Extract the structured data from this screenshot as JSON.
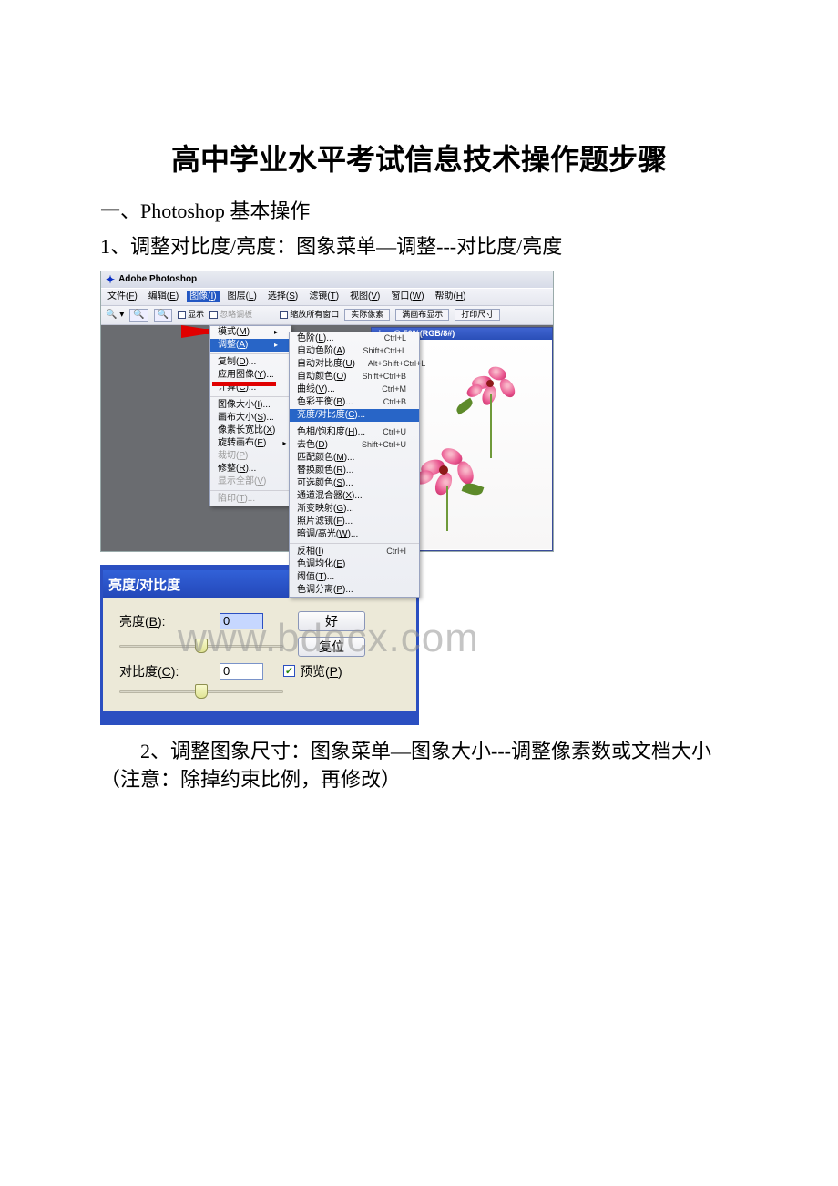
{
  "doc": {
    "title": "高中学业水平考试信息技术操作题步骤",
    "section1": "一、Photoshop 基本操作",
    "step1": "1、调整对比度/亮度：图象菜单—调整---对比度/亮度",
    "step2": "2、调整图象尺寸：图象菜单—图象大小---调整像素数或文档大小（注意：除掉约束比例，再修改）"
  },
  "ps": {
    "app_title": "Adobe Photoshop",
    "menubar": [
      "文件(F)",
      "编辑(E)",
      "图像(I)",
      "图层(L)",
      "选择(S)",
      "滤镜(T)",
      "视图(V)",
      "窗口(W)",
      "帮助(H)"
    ],
    "active_menu_index": 2,
    "optbar": {
      "opt_show_label": "显示",
      "opt_ignore_label": "忽略调板",
      "checkbox1": "缩放所有窗口",
      "buttons": [
        "实际像素",
        "满画布显示",
        "打印尺寸"
      ]
    },
    "menu1": {
      "items": [
        {
          "label": "模式(M)",
          "sub": true
        },
        {
          "label": "调整(A)",
          "sub": true,
          "hl": true
        },
        {
          "sep": true
        },
        {
          "label": "复制(D)..."
        },
        {
          "label": "应用图像(Y)..."
        },
        {
          "label": "计算(C)..."
        },
        {
          "sep": true
        },
        {
          "label": "图像大小(I)..."
        },
        {
          "label": "画布大小(S)..."
        },
        {
          "label": "像素长宽比(X)",
          "sub": true
        },
        {
          "label": "旋转画布(E)",
          "sub": true
        },
        {
          "label": "裁切(P)",
          "disabled": true
        },
        {
          "label": "修整(R)..."
        },
        {
          "label": "显示全部(V)",
          "disabled": true
        },
        {
          "sep": true
        },
        {
          "label": "陷印(T)...",
          "disabled": true
        }
      ]
    },
    "menu2": {
      "items": [
        {
          "label": "色阶(L)...",
          "short": "Ctrl+L"
        },
        {
          "label": "自动色阶(A)",
          "short": "Shift+Ctrl+L"
        },
        {
          "label": "自动对比度(U)",
          "short": "Alt+Shift+Ctrl+L"
        },
        {
          "label": "自动颜色(O)",
          "short": "Shift+Ctrl+B"
        },
        {
          "label": "曲线(V)...",
          "short": "Ctrl+M"
        },
        {
          "label": "色彩平衡(B)...",
          "short": "Ctrl+B"
        },
        {
          "label": "亮度/对比度(C)...",
          "hl": true
        },
        {
          "sep": true
        },
        {
          "label": "色相/饱和度(H)...",
          "short": "Ctrl+U"
        },
        {
          "label": "去色(D)",
          "short": "Shift+Ctrl+U"
        },
        {
          "label": "匹配颜色(M)..."
        },
        {
          "label": "替换颜色(R)..."
        },
        {
          "label": "可选颜色(S)..."
        },
        {
          "label": "通道混合器(X)..."
        },
        {
          "label": "渐变映射(G)..."
        },
        {
          "label": "照片滤镜(F)..."
        },
        {
          "label": "暗调/高光(W)..."
        },
        {
          "sep": true
        },
        {
          "label": "反相(I)",
          "short": "Ctrl+I"
        },
        {
          "label": "色调均化(E)"
        },
        {
          "label": "阈值(T)..."
        },
        {
          "label": "色调分离(P)..."
        }
      ]
    },
    "image_title": ".jpg @ 50%(RGB/8#)"
  },
  "dialog": {
    "title": "亮度/对比度",
    "brightness_label": "亮度(B):",
    "contrast_label": "对比度(C):",
    "brightness_value": "0",
    "contrast_value": "0",
    "ok": "好",
    "cancel": "复位",
    "preview": "预览(P)"
  },
  "watermark": "www.bdocx.com"
}
